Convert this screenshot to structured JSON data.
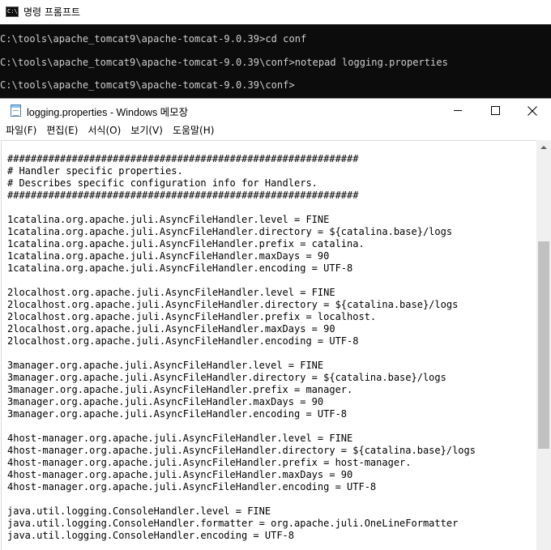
{
  "cmd": {
    "title": "명령 프롬프트",
    "icon_text": "C:\\",
    "lines": [
      "C:\\tools\\apache_tomcat9\\apache-tomcat-9.0.39>cd conf",
      "C:\\tools\\apache_tomcat9\\apache-tomcat-9.0.39\\conf>notepad logging.properties",
      "C:\\tools\\apache_tomcat9\\apache-tomcat-9.0.39\\conf>"
    ]
  },
  "notepad": {
    "title": "logging.properties - Windows 메모장",
    "menu": [
      "파일(F)",
      "편집(E)",
      "서식(O)",
      "보기(V)",
      "도움말(H)"
    ],
    "content": "############################################################\n# Handler specific properties.\n# Describes specific configuration info for Handlers.\n############################################################\n\n1catalina.org.apache.juli.AsyncFileHandler.level = FINE\n1catalina.org.apache.juli.AsyncFileHandler.directory = ${catalina.base}/logs\n1catalina.org.apache.juli.AsyncFileHandler.prefix = catalina.\n1catalina.org.apache.juli.AsyncFileHandler.maxDays = 90\n1catalina.org.apache.juli.AsyncFileHandler.encoding = UTF-8\n\n2localhost.org.apache.juli.AsyncFileHandler.level = FINE\n2localhost.org.apache.juli.AsyncFileHandler.directory = ${catalina.base}/logs\n2localhost.org.apache.juli.AsyncFileHandler.prefix = localhost.\n2localhost.org.apache.juli.AsyncFileHandler.maxDays = 90\n2localhost.org.apache.juli.AsyncFileHandler.encoding = UTF-8\n\n3manager.org.apache.juli.AsyncFileHandler.level = FINE\n3manager.org.apache.juli.AsyncFileHandler.directory = ${catalina.base}/logs\n3manager.org.apache.juli.AsyncFileHandler.prefix = manager.\n3manager.org.apache.juli.AsyncFileHandler.maxDays = 90\n3manager.org.apache.juli.AsyncFileHandler.encoding = UTF-8\n\n4host-manager.org.apache.juli.AsyncFileHandler.level = FINE\n4host-manager.org.apache.juli.AsyncFileHandler.directory = ${catalina.base}/logs\n4host-manager.org.apache.juli.AsyncFileHandler.prefix = host-manager.\n4host-manager.org.apache.juli.AsyncFileHandler.maxDays = 90\n4host-manager.org.apache.juli.AsyncFileHandler.encoding = UTF-8\n\njava.util.logging.ConsoleHandler.level = FINE\njava.util.logging.ConsoleHandler.formatter = org.apache.juli.OneLineFormatter\njava.util.logging.ConsoleHandler.encoding = UTF-8"
  },
  "icons": {
    "cmd": "command-prompt-icon",
    "notepad": "notepad-icon",
    "minimize": "minimize-icon",
    "maximize": "maximize-icon",
    "close": "close-icon",
    "scroll_up": "scroll-up-arrow-icon"
  }
}
